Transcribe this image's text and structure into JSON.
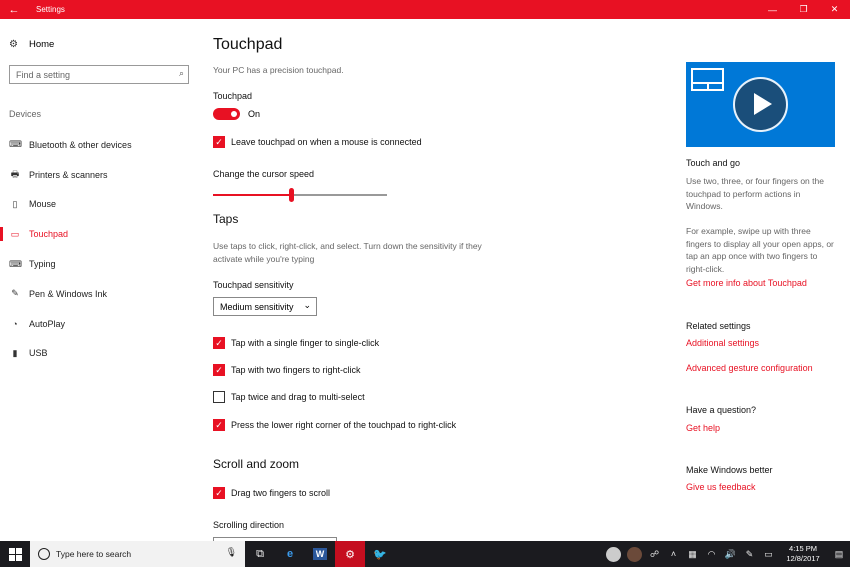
{
  "window": {
    "title": "Settings",
    "back": "←",
    "min": "—",
    "restore": "❐",
    "close": "✕"
  },
  "sidebar": {
    "home": "Home",
    "search_placeholder": "Find a setting",
    "section": "Devices",
    "items": [
      {
        "label": "Bluetooth & other devices",
        "icon": "bluetooth-icon",
        "glyph": "⌨"
      },
      {
        "label": "Printers & scanners",
        "icon": "printer-icon",
        "glyph": "🖶"
      },
      {
        "label": "Mouse",
        "icon": "mouse-icon",
        "glyph": "▯"
      },
      {
        "label": "Touchpad",
        "icon": "touchpad-icon",
        "glyph": "▭"
      },
      {
        "label": "Typing",
        "icon": "keyboard-icon",
        "glyph": "⌨"
      },
      {
        "label": "Pen & Windows Ink",
        "icon": "pen-icon",
        "glyph": "✎"
      },
      {
        "label": "AutoPlay",
        "icon": "autoplay-icon",
        "glyph": "◔"
      },
      {
        "label": "USB",
        "icon": "usb-icon",
        "glyph": "▮"
      }
    ]
  },
  "main": {
    "title": "Touchpad",
    "subtitle": "Your PC has a precision touchpad.",
    "touchpad_label": "Touchpad",
    "toggle_state": "On",
    "leave_touchpad": "Leave touchpad on when a mouse is connected",
    "cursor_speed_label": "Change the cursor speed",
    "cursor_speed_value": 0.45,
    "taps_heading": "Taps",
    "taps_desc": "Use taps to click, right-click, and select. Turn down the sensitivity if they activate while you're typing",
    "sensitivity_label": "Touchpad sensitivity",
    "sensitivity_value": "Medium sensitivity",
    "tap_options": [
      {
        "label": "Tap with a single finger to single-click",
        "checked": true
      },
      {
        "label": "Tap with two fingers to right-click",
        "checked": true
      },
      {
        "label": "Tap twice and drag to multi-select",
        "checked": false
      },
      {
        "label": "Press the lower right corner of the touchpad to right-click",
        "checked": true
      }
    ],
    "scroll_heading": "Scroll and zoom",
    "drag_two_fingers": "Drag two fingers to scroll",
    "scroll_direction_label": "Scrolling direction"
  },
  "right": {
    "touch_go_title": "Touch and go",
    "touch_go_p1": "Use two, three, or four fingers on the touchpad to perform actions in Windows.",
    "touch_go_p2": "For example, swipe up with three fingers to display all your open apps, or tap an app once with two fingers to right-click.",
    "more_info_link": "Get more info about Touchpad",
    "related_title": "Related settings",
    "additional_link": "Additional settings",
    "advanced_link": "Advanced gesture configuration",
    "question_title": "Have a question?",
    "get_help_link": "Get help",
    "better_title": "Make Windows better",
    "feedback_link": "Give us feedback"
  },
  "taskbar": {
    "search_text": "Type here to search",
    "time": "4:15 PM",
    "date": "12/8/2017"
  },
  "colors": {
    "accent": "#e81123",
    "video_bg": "#0078d7",
    "taskbar": "#1b1b1f"
  }
}
